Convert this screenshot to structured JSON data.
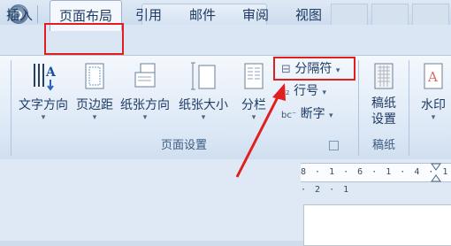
{
  "tabs": [
    "插入",
    "页面布局",
    "引用",
    "邮件",
    "审阅",
    "视图"
  ],
  "ribbon": {
    "text_direction": "文字方向",
    "margins": "页边距",
    "orientation": "纸张方向",
    "size": "纸张大小",
    "columns": "分栏",
    "breaks": "分隔符",
    "line_numbers": "行号",
    "hyphenation": "断字",
    "page_setup_group": "页面设置",
    "draft_paper_line1": "稿纸",
    "draft_paper_line2": "设置",
    "draft_paper_group": "稿纸",
    "watermark": "水印"
  },
  "ruler": "8 · 1 · 6 · 1 · 4 · 1 · 2 · 1"
}
